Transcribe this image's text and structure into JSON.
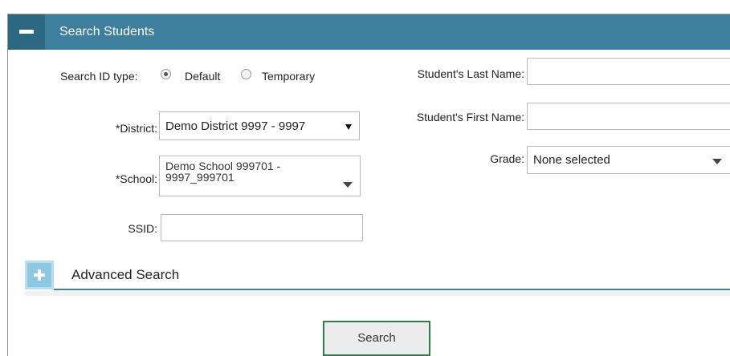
{
  "panel": {
    "title": "Search Students"
  },
  "search_id_type": {
    "label": "Search ID type:",
    "options": [
      "Default",
      "Temporary"
    ],
    "selected": "Default"
  },
  "district": {
    "label": "*District:",
    "value": "Demo District 9997 - 9997"
  },
  "school": {
    "label": "*School:",
    "value_line1": "Demo School 999701 -",
    "value_line2": "9997_999701"
  },
  "ssid": {
    "label": "SSID:",
    "value": ""
  },
  "last_name": {
    "label": "Student's Last Name:",
    "value": ""
  },
  "first_name": {
    "label": "Student's First Name:",
    "value": ""
  },
  "grade": {
    "label": "Grade:",
    "value": "None selected"
  },
  "advanced": {
    "title": "Advanced Search"
  },
  "search_button": {
    "label": "Search"
  },
  "colors": {
    "header": "#3d7f9c",
    "header_dark": "#2c6882",
    "search_border": "#2e7d4f",
    "adv_plus": "#8cc8e4"
  },
  "icons": {
    "collapse": "minus-icon",
    "expand": "plus-icon",
    "dropdown": "caret-down-icon"
  }
}
